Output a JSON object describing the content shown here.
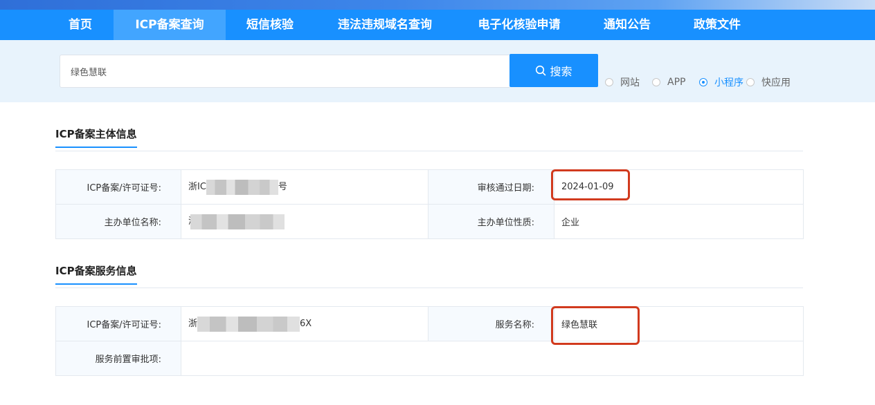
{
  "nav": {
    "items": [
      "首页",
      "ICP备案查询",
      "短信核验",
      "违法违规域名查询",
      "电子化核验申请",
      "通知公告",
      "政策文件"
    ],
    "active_index": 1
  },
  "search": {
    "value": "绿色慧联",
    "button_label": "搜索",
    "options": [
      "网站",
      "APP",
      "小程序",
      "快应用"
    ],
    "selected": "小程序"
  },
  "subject_section": {
    "title": "ICP备案主体信息",
    "rows": [
      {
        "label1": "ICP备案/许可证号:",
        "value1_prefix": "浙IC",
        "value1_suffix": "号",
        "label2": "审核通过日期:",
        "value2": "2024-01-09"
      },
      {
        "label1": "主办单位名称:",
        "value1_prefix": "浙",
        "value1_suffix": "",
        "label2": "主办单位性质:",
        "value2": "企业"
      }
    ]
  },
  "service_section": {
    "title": "ICP备案服务信息",
    "rows": [
      {
        "label1": "ICP备案/许可证号:",
        "value1_prefix": "浙",
        "value1_suffix": "6X",
        "label2": "服务名称:",
        "value2": "绿色慧联"
      },
      {
        "label1": "服务前置审批项:",
        "value1_prefix": "",
        "value1_suffix": ""
      }
    ]
  },
  "colors": {
    "primary": "#1890ff",
    "highlight": "#d13a1e"
  }
}
